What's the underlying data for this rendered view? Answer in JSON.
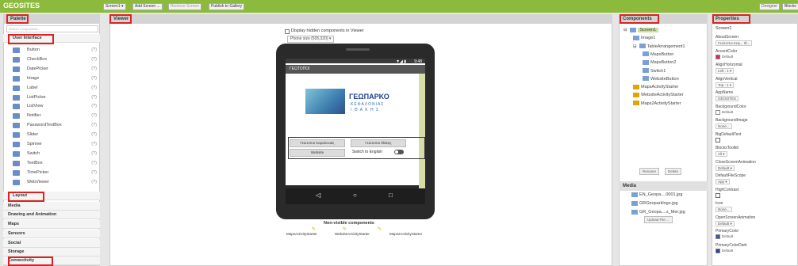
{
  "topbar": {
    "title": "GEOSITES",
    "screen_select": "Screen1 ▾",
    "add_screen": "Add Screen ...",
    "remove_screen": "Remove Screen",
    "publish": "Publish to Gallery",
    "designer": "Designer",
    "blocks": "Blocks"
  },
  "palette": {
    "header": "Palette",
    "search_placeholder": "Search Components...",
    "category_ui": "User Interface",
    "items": [
      {
        "label": "Button",
        "icon": "button-icon"
      },
      {
        "label": "CheckBox",
        "icon": "checkbox-icon"
      },
      {
        "label": "DatePicker",
        "icon": "datepicker-icon"
      },
      {
        "label": "Image",
        "icon": "image-icon"
      },
      {
        "label": "Label",
        "icon": "label-icon"
      },
      {
        "label": "ListPicker",
        "icon": "listpicker-icon"
      },
      {
        "label": "ListView",
        "icon": "listview-icon"
      },
      {
        "label": "Notifier",
        "icon": "notifier-icon"
      },
      {
        "label": "PasswordTextBox",
        "icon": "password-icon"
      },
      {
        "label": "Slider",
        "icon": "slider-icon"
      },
      {
        "label": "Spinner",
        "icon": "spinner-icon"
      },
      {
        "label": "Switch",
        "icon": "switch-icon"
      },
      {
        "label": "TextBox",
        "icon": "textbox-icon"
      },
      {
        "label": "TimePicker",
        "icon": "timepicker-icon"
      },
      {
        "label": "WebViewer",
        "icon": "webviewer-icon"
      }
    ],
    "help_glyph": "(?)",
    "categories": [
      "Layout",
      "Media",
      "Drawing and Animation",
      "Maps",
      "Sensors",
      "Social",
      "Storage",
      "Connectivity"
    ]
  },
  "viewer": {
    "header": "Viewer",
    "hidden_checkbox_label": "Display hidden components in Viewer",
    "phone_size": "Phone size (505,320)  ▾",
    "status_time": "9:48",
    "app_title": "ΓΕΩΤΟΠΟΙ",
    "logo_title": "ΓΕΩΠΑΡΚΟ",
    "logo_sub1": "ΚΕΦΑΛΟΝΙΑΣ",
    "logo_sub2": "Ι Θ Α Κ Η Σ",
    "map_btn1": "Γεώτοποι Κεφαλονιάς",
    "map_btn2": "Γεώτοποι Ιθάκης",
    "website_btn": "Website",
    "switch_label": "Switch to English",
    "nonvisible_title": "Non-visible components",
    "nonvisible": [
      "MapsActivityStarter",
      "WebsiteActivityStarter",
      "Maps2ActivityStarter"
    ]
  },
  "components": {
    "header": "Components",
    "tree": [
      {
        "label": "Screen1",
        "level": 0,
        "toggle": "⊟"
      },
      {
        "label": "Image1",
        "level": 1,
        "toggle": ""
      },
      {
        "label": "TableArrangement1",
        "level": 1,
        "toggle": "⊟"
      },
      {
        "label": "MapsButton",
        "level": 2,
        "toggle": ""
      },
      {
        "label": "MapsButton2",
        "level": 2,
        "toggle": ""
      },
      {
        "label": "Switch1",
        "level": 2,
        "toggle": ""
      },
      {
        "label": "WebsiteButton",
        "level": 2,
        "toggle": ""
      },
      {
        "label": "MapsActivityStarter",
        "level": 1,
        "toggle": ""
      },
      {
        "label": "WebsiteActivityStarter",
        "level": 1,
        "toggle": ""
      },
      {
        "label": "Maps2ActivityStarter",
        "level": 1,
        "toggle": ""
      }
    ],
    "rename": "Rename",
    "delete": "Delete",
    "media_header": "Media",
    "media": [
      "EN_Geopa....0001.jpg",
      "GRGeoparklogo.jpg",
      "GR_Geopa....s_Mer.jpg"
    ],
    "upload": "Upload File ..."
  },
  "properties": {
    "header": "Properties",
    "screen": "Screen1",
    "items": [
      {
        "label": "AboutScreen",
        "value": "Γεώτοποι Κεφ... Ιθ..."
      },
      {
        "label": "AccentColor",
        "value": "Default",
        "swatch": "#e0245e"
      },
      {
        "label": "AlignHorizontal",
        "value": "Left : 1 ▾"
      },
      {
        "label": "AlignVertical",
        "value": "Top : 1 ▾"
      },
      {
        "label": "AppName",
        "value": "GEOSITES"
      },
      {
        "label": "BackgroundColor",
        "value": "Default",
        "swatch": "#ffffff"
      },
      {
        "label": "BackgroundImage",
        "value": "None..."
      },
      {
        "label": "BigDefaultText",
        "value": ""
      },
      {
        "label": "BlocksToolkit",
        "value": "All ▾"
      },
      {
        "label": "CloseScreenAnimation",
        "value": "Default ▾"
      },
      {
        "label": "DefaultFileScope",
        "value": "App ▾"
      },
      {
        "label": "HighContrast",
        "value": ""
      },
      {
        "label": "Icon",
        "value": "None..."
      },
      {
        "label": "OpenScreenAnimation",
        "value": "Default ▾"
      },
      {
        "label": "PrimaryColor",
        "value": "Default",
        "swatch": "#3f51b5"
      },
      {
        "label": "PrimaryColorDark",
        "value": "Default",
        "swatch": "#303f9f"
      }
    ]
  }
}
